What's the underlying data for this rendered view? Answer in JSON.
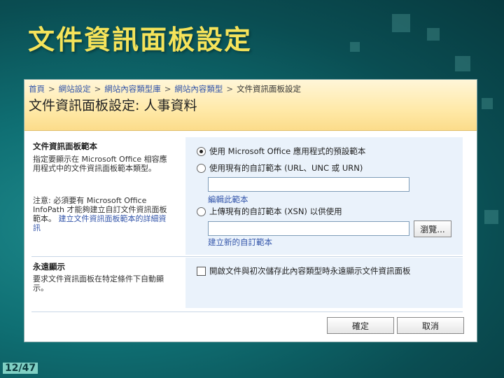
{
  "slide": {
    "title": "文件資訊面板設定",
    "number": "12/47"
  },
  "breadcrumb": {
    "items": [
      "首頁",
      "網站設定",
      "網站內容類型庫",
      "網站內容類型"
    ],
    "current": "文件資訊面板設定",
    "separator": ">"
  },
  "page_title": "文件資訊面板設定: 人事資料",
  "template_section": {
    "title": "文件資訊面板範本",
    "description": "指定要顯示在 Microsoft Office 相容應用程式中的文件資訊面板範本類型。",
    "note": "注意: 必須要有 Microsoft Office InfoPath 才能夠建立自訂文件資訊面板範本。",
    "note_link": "建立文件資訊面板範本的詳細資訊",
    "options": [
      {
        "label": "使用 Microsoft Office 應用程式的預設範本",
        "checked": true
      },
      {
        "label": "使用現有的自訂範本 (URL、UNC 或 URN)",
        "checked": false
      },
      {
        "label": "上傳現有的自訂範本 (XSN) 以供使用",
        "checked": false
      }
    ],
    "url_value": "",
    "upload_value": "",
    "edit_link": "編輯此範本",
    "browse_label": "瀏覽...",
    "create_link": "建立新的自訂範本"
  },
  "always_section": {
    "title": "永遠顯示",
    "description": "要求文件資訊面板在特定條件下自動顯示。",
    "checkbox_label": "開啟文件與初次儲存此內容類型時永遠顯示文件資訊面板",
    "checked": false
  },
  "buttons": {
    "ok": "確定",
    "cancel": "取消"
  }
}
